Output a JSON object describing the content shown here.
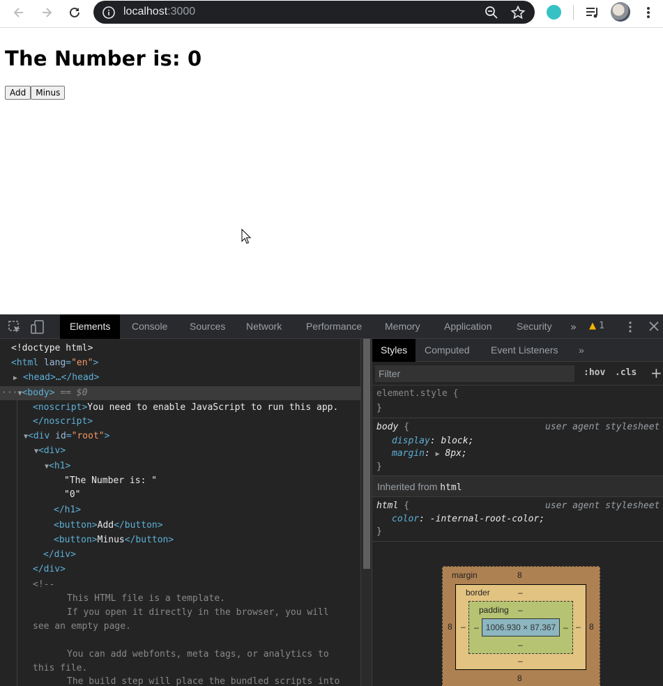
{
  "browser": {
    "url_host": "localhost",
    "url_port": ":3000"
  },
  "page": {
    "heading": "The Number is: 0",
    "add_label": "Add",
    "minus_label": "Minus"
  },
  "devtools": {
    "tabs": [
      "Elements",
      "Console",
      "Sources",
      "Network",
      "Performance",
      "Memory",
      "Application",
      "Security"
    ],
    "more": "»",
    "warning_count": "1",
    "dom": {
      "doctype": "<!doctype html>",
      "html_open_tag": "<html",
      "html_attr": "lang",
      "html_attr_val": "\"en\"",
      "head": "<head>…</head>",
      "body_tag": "<body>",
      "body_ref": "== $0",
      "noscript_open": "<noscript>",
      "noscript_text": "You need to enable JavaScript to run this app.",
      "noscript_close": "</noscript>",
      "div_root_tag": "<div",
      "div_root_attr": "id",
      "div_root_val": "\"root\"",
      "div": "<div>",
      "h1": "<h1>",
      "text1": "\"The Number is: \"",
      "text2": "\"0\"",
      "h1_close": "</h1>",
      "btn_open": "<button>",
      "btn_add": "Add",
      "btn_minus": "Minus",
      "btn_close": "</button>",
      "div_close": "</div>",
      "comment_open": "<!--",
      "comment_1": "This HTML file is a template.",
      "comment_2": "If you open it directly in the browser, you will",
      "comment_3": "see an empty page.",
      "comment_4": "You can add webfonts, meta tags, or analytics to",
      "comment_5": "this file.",
      "comment_6": "The build step will place the bundled scripts into"
    },
    "styles": {
      "tabs": [
        "Styles",
        "Computed",
        "Event Listeners"
      ],
      "more": "»",
      "filter_placeholder": "Filter",
      "hov": ":hov",
      "cls": ".cls",
      "plus": "+",
      "element_style": "element.style {",
      "close_brace": "}",
      "body_selector": "body",
      "open_brace": "{",
      "ua_source": "user agent stylesheet",
      "prop_display": "display",
      "val_display": "block;",
      "prop_margin": "margin",
      "val_margin": "8px;",
      "inherited_label": "Inherited from",
      "inherited_tag": "html",
      "html_selector": "html",
      "prop_color": "color",
      "val_color": "-internal-root-color;",
      "colon": ":"
    },
    "box_model": {
      "margin_label": "margin",
      "margin_top": "8",
      "margin_bottom": "8",
      "margin_left": "8",
      "margin_right": "8",
      "border_label": "border",
      "border_top": "–",
      "border_bottom": "–",
      "border_left": "–",
      "border_right": "–",
      "padding_label": "padding",
      "padding_top": "–",
      "padding_bottom": "–",
      "padding_left": "–",
      "padding_right": "–",
      "content": "1006.930 × 87.367"
    }
  }
}
